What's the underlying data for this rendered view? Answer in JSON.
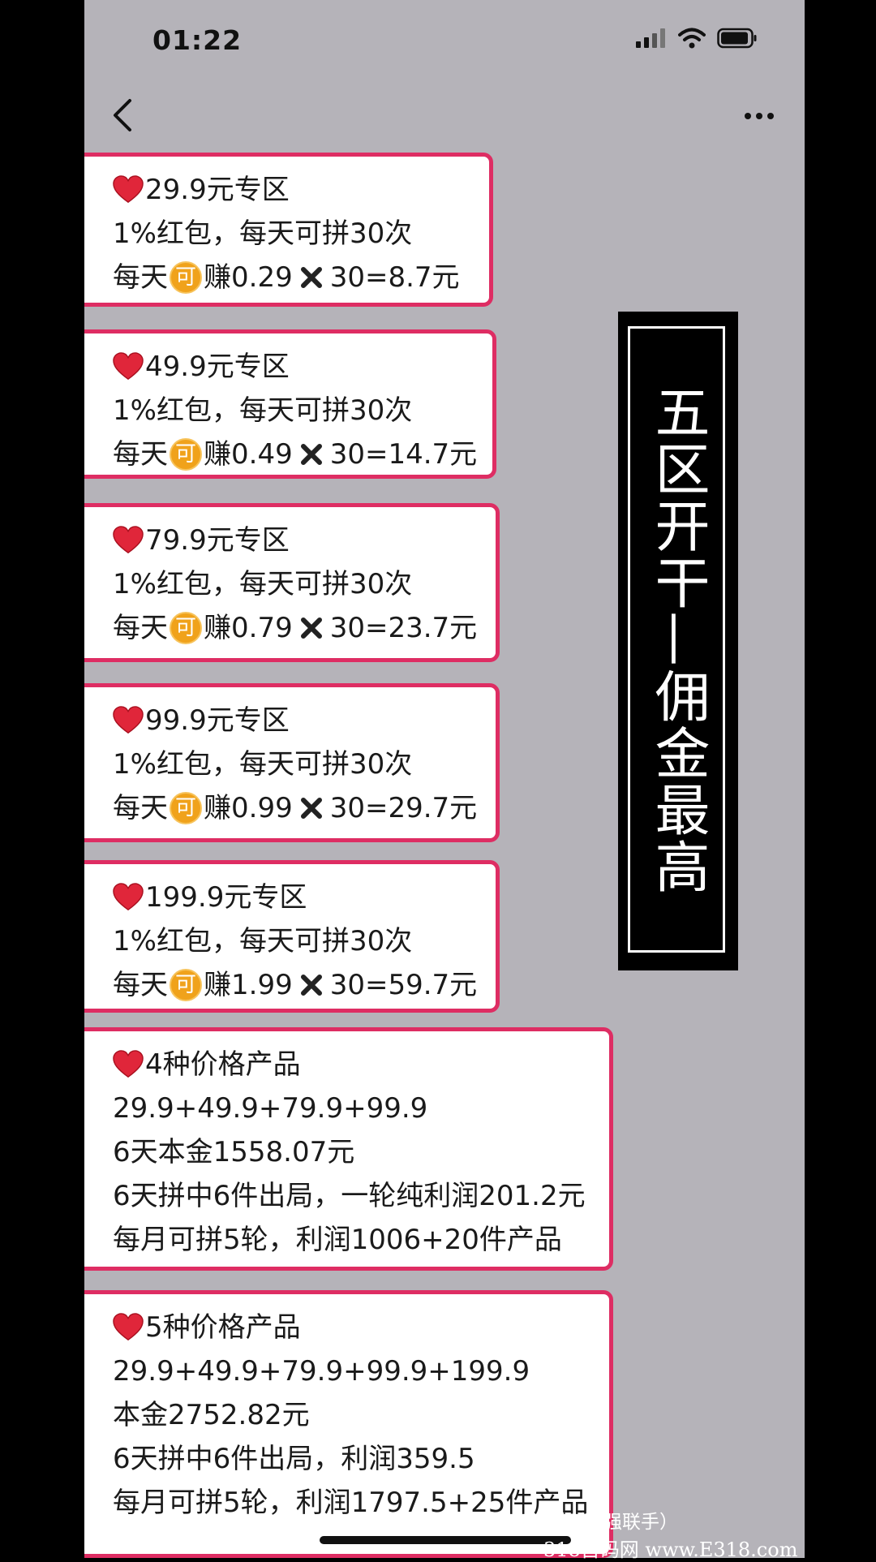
{
  "status_bar": {
    "time": "01:22"
  },
  "cards": [
    {
      "lines": [
        {
          "type": "title",
          "text": "29.9元专区"
        },
        {
          "type": "plain",
          "text": "1%红包，每天可拼30次"
        },
        {
          "type": "earn",
          "prefix": "每天",
          "coin": "可",
          "mid": "赚0.29",
          "suffix": "30=8.7元"
        }
      ]
    },
    {
      "lines": [
        {
          "type": "title",
          "text": "49.9元专区"
        },
        {
          "type": "plain",
          "text": "1%红包，每天可拼30次"
        },
        {
          "type": "earn",
          "prefix": "每天",
          "coin": "可",
          "mid": "赚0.49",
          "suffix": "30=14.7元"
        }
      ]
    },
    {
      "lines": [
        {
          "type": "title",
          "text": "79.9元专区"
        },
        {
          "type": "plain",
          "text": "1%红包，每天可拼30次"
        },
        {
          "type": "earn",
          "prefix": "每天",
          "coin": "可",
          "mid": "赚0.79",
          "suffix": "30=23.7元"
        }
      ]
    },
    {
      "lines": [
        {
          "type": "title",
          "text": "99.9元专区"
        },
        {
          "type": "plain",
          "text": "1%红包，每天可拼30次"
        },
        {
          "type": "earn",
          "prefix": "每天",
          "coin": "可",
          "mid": "赚0.99",
          "suffix": "30=29.7元"
        }
      ]
    },
    {
      "lines": [
        {
          "type": "title",
          "text": "199.9元专区"
        },
        {
          "type": "plain",
          "text": "1%红包，每天可拼30次"
        },
        {
          "type": "earn",
          "prefix": "每天",
          "coin": "可",
          "mid": "赚1.99",
          "suffix": "30=59.7元"
        }
      ]
    },
    {
      "lines": [
        {
          "type": "title",
          "text": "4种价格产品"
        },
        {
          "type": "plain",
          "text": "29.9+49.9+79.9+99.9"
        },
        {
          "type": "plain",
          "text": "6天本金1558.07元"
        },
        {
          "type": "plain",
          "text": "6天拼中6件出局，一轮纯利润201.2元"
        },
        {
          "type": "plain",
          "text": "每月可拼5轮，利润1006+20件产品"
        }
      ]
    },
    {
      "lines": [
        {
          "type": "title",
          "text": "5种价格产品"
        },
        {
          "type": "plain",
          "text": "29.9+49.9+79.9+99.9+199.9"
        },
        {
          "type": "plain",
          "text": "本金2752.82元"
        },
        {
          "type": "plain",
          "text": "6天拼中6件出局，利润359.5"
        },
        {
          "type": "plain",
          "text": "每月可拼5轮，利润1797.5+25件产品"
        }
      ]
    }
  ],
  "banner": {
    "text": "五区开干—佣金最高"
  },
  "watermark": {
    "line1": "拼拼（强强联手）",
    "line2": "318首码网 www.E318.com"
  },
  "colors": {
    "card_border": "#de2d63",
    "heart": "#e0263a",
    "coin": "#f0a21b",
    "background": "#b5b3b9"
  }
}
